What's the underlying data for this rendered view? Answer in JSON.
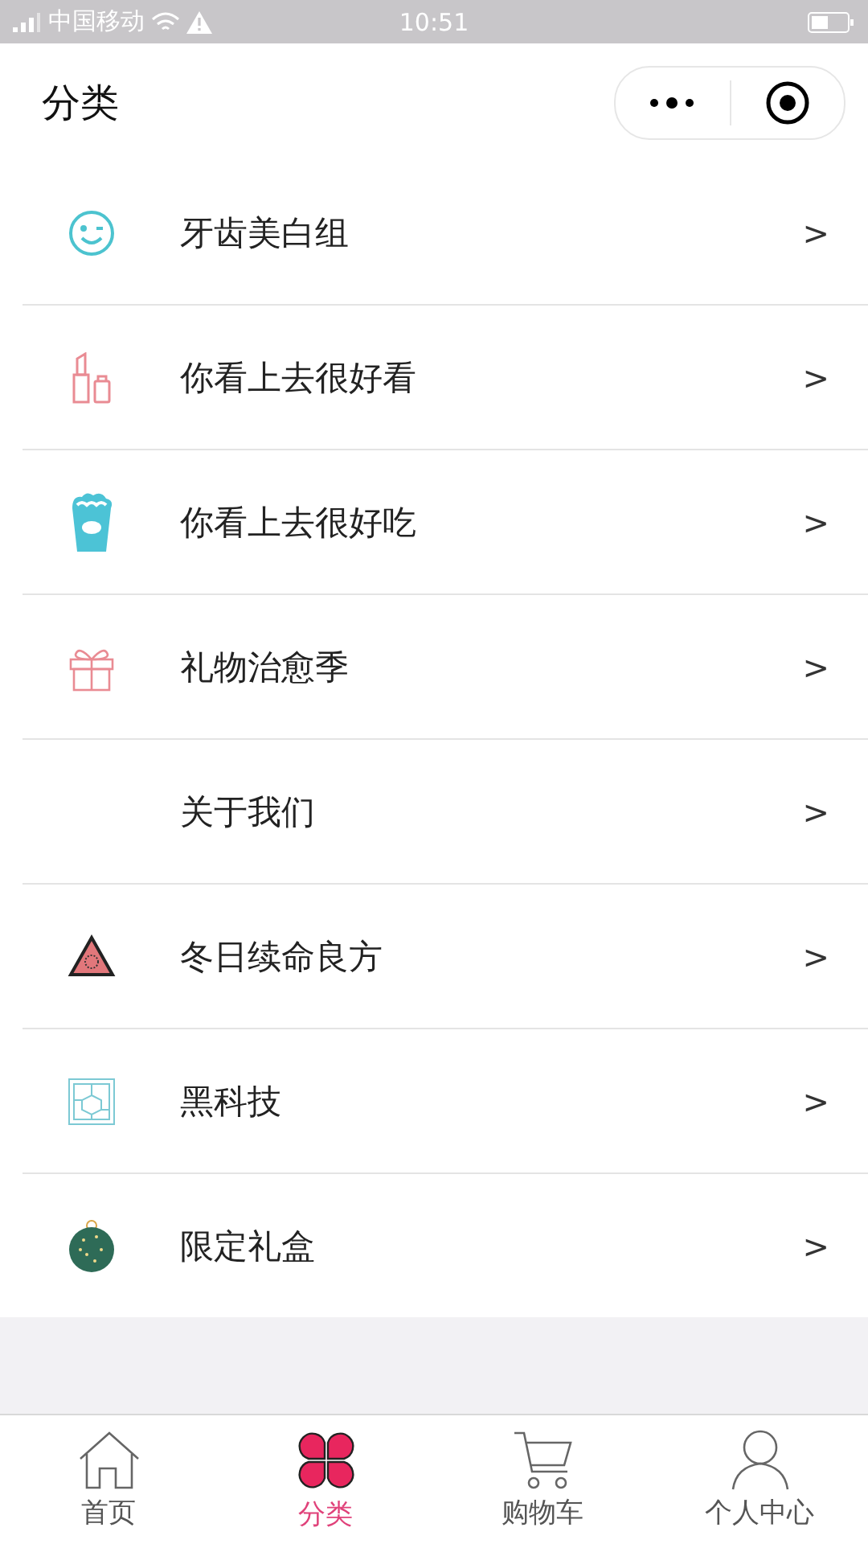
{
  "status_bar": {
    "carrier": "中国移动",
    "time": "10:51"
  },
  "header": {
    "title": "分类"
  },
  "categories": [
    {
      "label": "牙齿美白组",
      "arrow": ">"
    },
    {
      "label": "你看上去很好看",
      "arrow": ">"
    },
    {
      "label": "你看上去很好吃",
      "arrow": ">"
    },
    {
      "label": "礼物治愈季",
      "arrow": ">"
    },
    {
      "label": "关于我们",
      "arrow": ">"
    },
    {
      "label": "冬日续命良方",
      "arrow": ">"
    },
    {
      "label": "黑科技",
      "arrow": ">"
    },
    {
      "label": "限定礼盒",
      "arrow": ">"
    }
  ],
  "tab_bar": [
    {
      "label": "首页",
      "selected": false
    },
    {
      "label": "分类",
      "selected": true
    },
    {
      "label": "购物车",
      "selected": false
    },
    {
      "label": "个人中心",
      "selected": false
    }
  ]
}
